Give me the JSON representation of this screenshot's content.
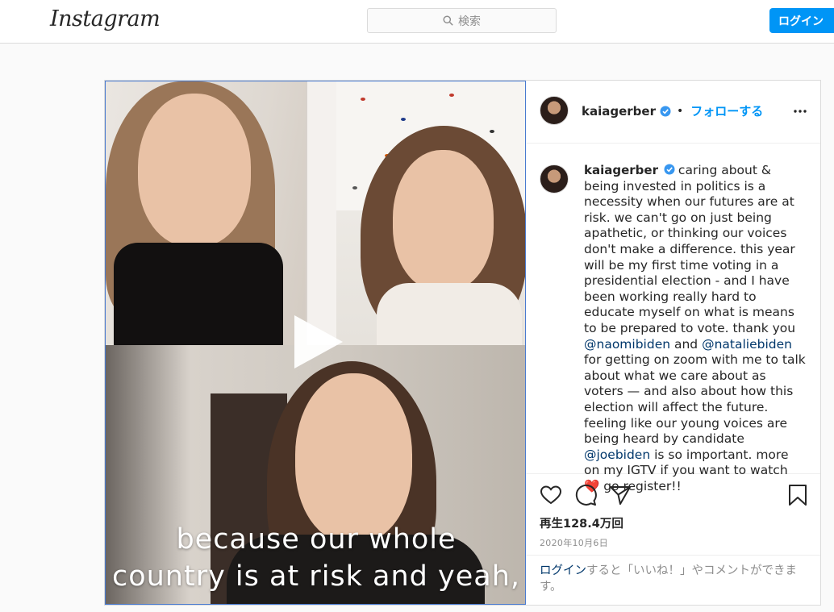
{
  "nav": {
    "logo": "Instagram",
    "search_placeholder": "検索",
    "login_label": "ログイン"
  },
  "post": {
    "username": "kaiagerber",
    "follow_label": "フォローする",
    "separator": "•",
    "video_caption_line1": "because our whole",
    "video_caption_line2": "country is at risk and yeah,",
    "caption": {
      "part1": "caring about & being invested in politics is a necessity when our futures are at risk. we can't go on just being apathetic, or thinking our voices don't make a difference. this year will be my first time voting in a presidential election - and I have been working really hard to educate myself on what is means to be prepared to vote. thank you ",
      "mention1": "@naomibiden",
      "part2": " and ",
      "mention2": "@nataliebiden",
      "part3": " for getting on zoom with me to talk about what we care about as voters — and also about how this election will affect the future. feeling like our young voices are being heard by candidate ",
      "mention3": "@joebiden",
      "part4": " is so important. more on my IGTV if you want to watch ",
      "emoji": "❤️",
      "part5": " go register!!"
    },
    "views": "再生128.4万回",
    "date": "2020年10月6日",
    "login_link": "ログイン",
    "login_note": "すると「いいね！」やコメントができます。"
  },
  "colors": {
    "accent": "#0095f6",
    "mention": "#00376b"
  },
  "icons": [
    "search-icon",
    "verified-icon",
    "more-options-icon",
    "play-icon",
    "like-icon",
    "comment-icon",
    "share-icon",
    "save-icon"
  ]
}
